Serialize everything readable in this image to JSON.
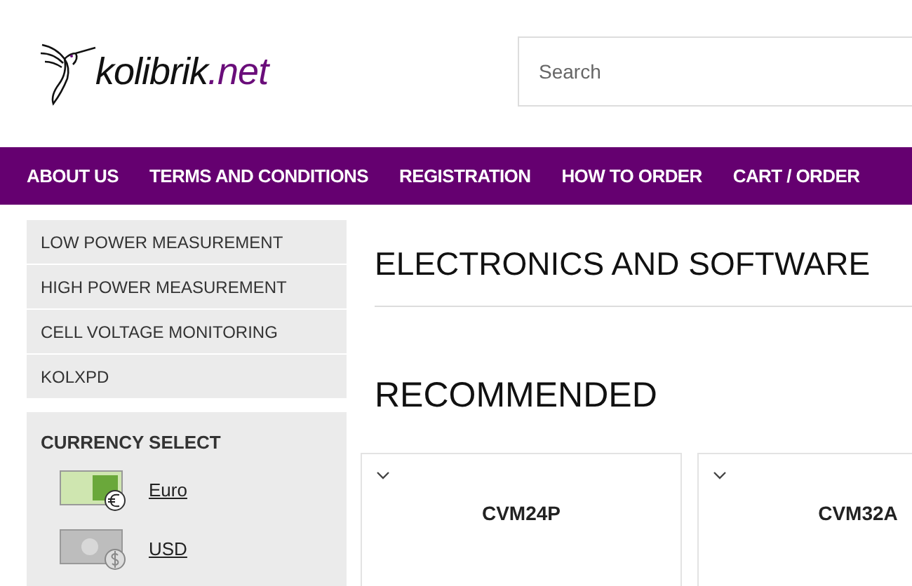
{
  "header": {
    "logo_text": "kolibrik",
    "logo_tld": ".net",
    "search": {
      "placeholder": "Search"
    }
  },
  "nav": {
    "items": [
      {
        "label": "ABOUT US"
      },
      {
        "label": "TERMS AND CONDITIONS"
      },
      {
        "label": "REGISTRATION"
      },
      {
        "label": "HOW TO ORDER"
      },
      {
        "label": "CART / ORDER"
      }
    ]
  },
  "sidebar": {
    "items": [
      {
        "label": "LOW POWER MEASUREMENT"
      },
      {
        "label": "HIGH POWER MEASUREMENT"
      },
      {
        "label": "CELL VOLTAGE MONITORING"
      },
      {
        "label": "KOLXPD"
      }
    ],
    "currency": {
      "title": "CURRENCY SELECT",
      "options": [
        {
          "kind": "euro",
          "label": "Euro"
        },
        {
          "kind": "usd",
          "label": "USD"
        }
      ]
    }
  },
  "main": {
    "title": "ELECTRONICS AND SOFTWARE",
    "section": "RECOMMENDED",
    "products": [
      {
        "name": "CVM24P"
      },
      {
        "name": "CVM32A"
      }
    ]
  }
}
